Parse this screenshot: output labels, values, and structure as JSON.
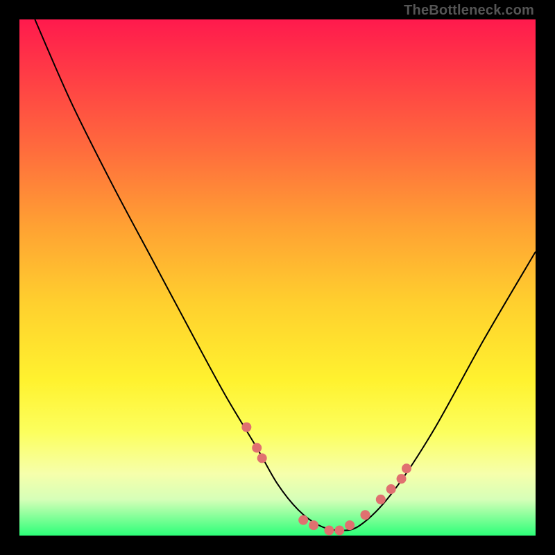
{
  "attribution": "TheBottleneck.com",
  "chart_data": {
    "type": "line",
    "title": "",
    "xlabel": "",
    "ylabel": "",
    "xlim": [
      0,
      100
    ],
    "ylim": [
      0,
      100
    ],
    "background_gradient": [
      "#ff1a4d",
      "#ff6b3d",
      "#ffd02e",
      "#fcff5e",
      "#2cff78"
    ],
    "series": [
      {
        "name": "bottleneck-curve",
        "x": [
          3,
          10,
          18,
          26,
          34,
          40,
          46,
          50,
          54,
          58,
          62,
          66,
          72,
          80,
          90,
          100
        ],
        "y": [
          100,
          84,
          68,
          53,
          38,
          27,
          17,
          10,
          5,
          2,
          1,
          2,
          8,
          20,
          38,
          55
        ]
      }
    ],
    "markers": {
      "name": "highlight-dots",
      "color": "#e07070",
      "x": [
        44,
        46,
        47,
        55,
        57,
        60,
        62,
        64,
        67,
        70,
        72,
        74,
        75
      ],
      "y": [
        21,
        17,
        15,
        3,
        2,
        1,
        1,
        2,
        4,
        7,
        9,
        11,
        13
      ]
    }
  }
}
